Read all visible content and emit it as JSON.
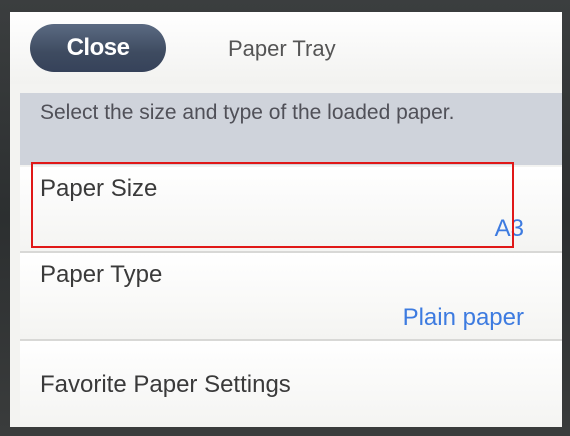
{
  "header": {
    "close_label": "Close",
    "title": "Paper Tray"
  },
  "instruction": "Select the size and type of the loaded paper.",
  "settings": [
    {
      "label": "Paper Size",
      "value": "A3"
    },
    {
      "label": "Paper Type",
      "value": "Plain paper"
    },
    {
      "label": "Favorite Paper Settings"
    }
  ],
  "colors": {
    "accent_value": "#3d7be0",
    "close_button": "#3e4b60",
    "highlight_box": "#e01818",
    "instruction_bg": "#cfd3db"
  }
}
